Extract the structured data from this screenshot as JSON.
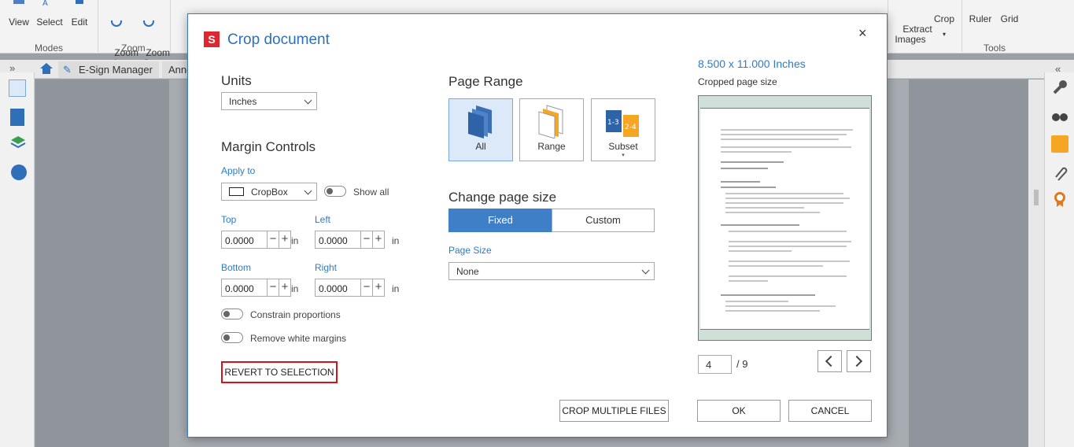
{
  "ribbon": {
    "buttons": [
      {
        "label": "View"
      },
      {
        "label": "Select"
      },
      {
        "label": "Edit"
      },
      {
        "label": "Zoom\nIn"
      },
      {
        "label": "Zoom\nOut"
      },
      {
        "label": "Extract\nImages"
      },
      {
        "label": "Crop"
      },
      {
        "label": "Ruler"
      },
      {
        "label": "Grid"
      }
    ],
    "groups": {
      "modes": "Modes",
      "zoom": "Zoom",
      "tools": "Tools"
    }
  },
  "tabs": {
    "esign": "E-Sign Manager",
    "annot": "Anno"
  },
  "dialog": {
    "title": "Crop document",
    "units_heading": "Units",
    "units_value": "Inches",
    "margin_heading": "Margin Controls",
    "apply_to_label": "Apply to",
    "apply_to_value": "CropBox",
    "show_all_label": "Show all",
    "top_label": "Top",
    "left_label": "Left",
    "bottom_label": "Bottom",
    "right_label": "Right",
    "top_value": "0.0000",
    "left_value": "0.0000",
    "bottom_value": "0.0000",
    "right_value": "0.0000",
    "unit_in": "in",
    "constrain_label": "Constrain proportions",
    "remove_white_label": "Remove white margins",
    "revert_label": "REVERT TO SELECTION",
    "page_range_heading": "Page Range",
    "range_all": "All",
    "range_range": "Range",
    "range_subset": "Subset",
    "change_size_heading": "Change page size",
    "fixed_label": "Fixed",
    "custom_label": "Custom",
    "page_size_label": "Page Size",
    "page_size_value": "None",
    "size_dimensions": "8.500 x 11.000 Inches",
    "cropped_label": "Cropped page size",
    "current_page": "4",
    "total_pages": "/ 9",
    "crop_multiple_label": "CROP MULTIPLE FILES",
    "ok_label": "OK",
    "cancel_label": "CANCEL",
    "close_glyph": "×",
    "logo_letter": "S"
  },
  "colors": {
    "accent": "#3f7fc7",
    "title": "#2e6fb7",
    "revert_border": "#d3131c",
    "logo": "#e0262f"
  }
}
